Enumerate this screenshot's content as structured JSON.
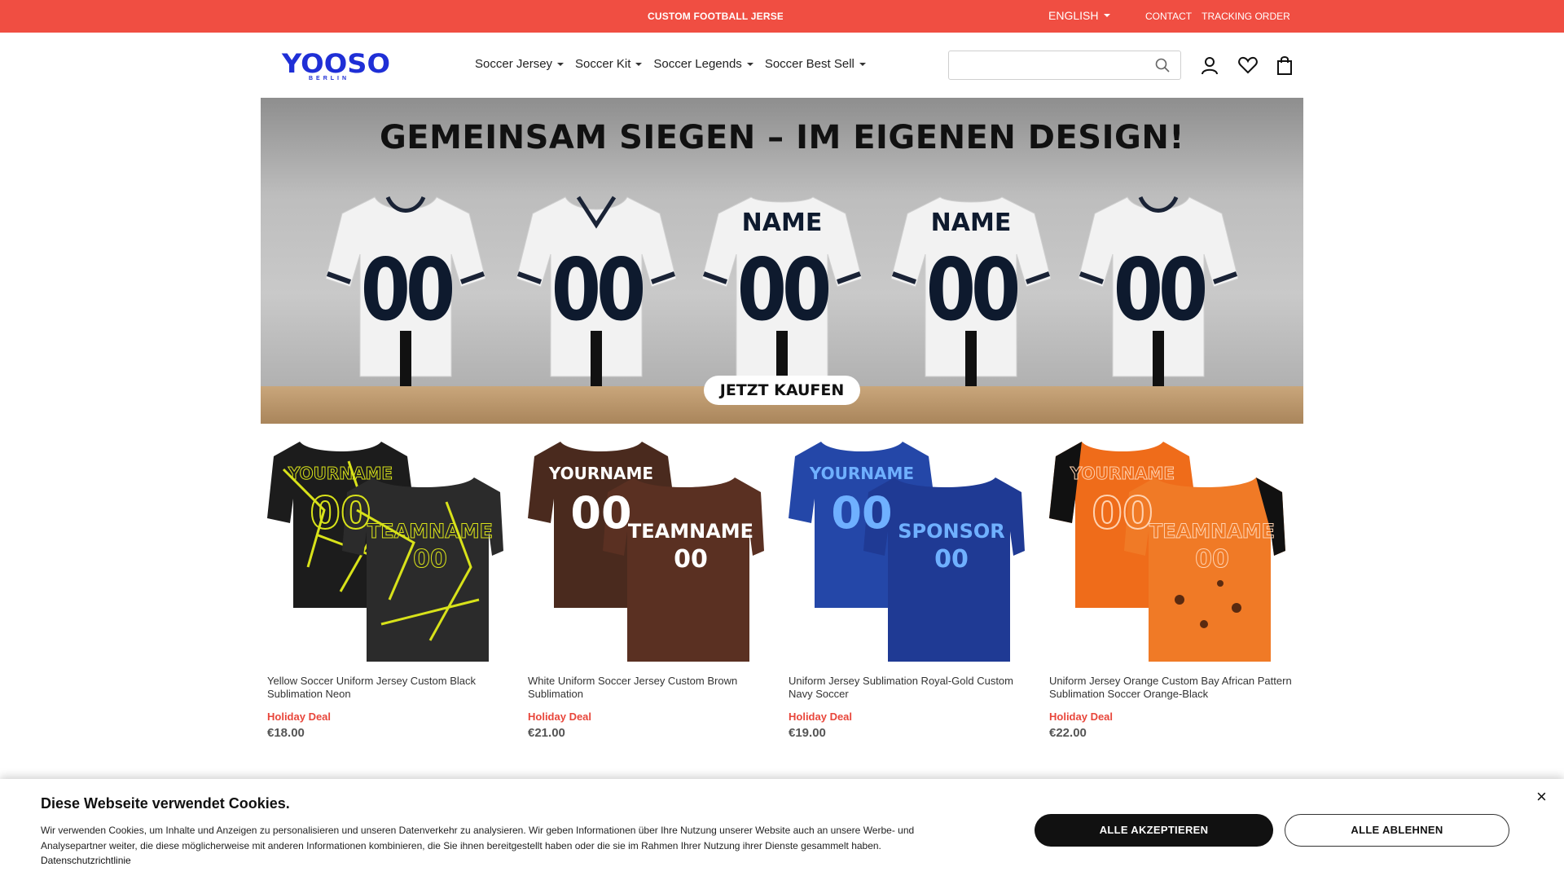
{
  "topbar": {
    "promo": "CUSTOM FOOTBALL JERSEY",
    "language": "ENGLISH",
    "links": [
      "CONTACT",
      "TRACKING ORDER"
    ]
  },
  "header": {
    "logo": {
      "brand": "YOOSO",
      "sub": "BERLIN"
    },
    "nav": [
      "Soccer Jersey",
      "Soccer Kit",
      "Soccer Legends",
      "Soccer Best Sell"
    ],
    "search": {
      "placeholder": "",
      "value": ""
    },
    "icons": [
      "search-icon",
      "account-icon",
      "wishlist-heart-icon",
      "cart-bag-icon"
    ]
  },
  "hero": {
    "headline": "GEMEINSAM SIEGEN – IM EIGENEN DESIGN!",
    "jerseys": [
      {
        "name": "",
        "number": "00"
      },
      {
        "name": "",
        "number": "00"
      },
      {
        "name": "NAME",
        "number": "00"
      },
      {
        "name": "NAME",
        "number": "00"
      },
      {
        "name": "",
        "number": "00"
      }
    ],
    "cta": "JETZT KAUFEN"
  },
  "products": [
    {
      "title": "Yellow Soccer Uniform Jersey Custom Black Sublimation Neon",
      "deal": "Holiday Deal",
      "price": "€18.00",
      "colors": {
        "base": "#1c1c1c",
        "accent": "#d8e21a"
      },
      "print": {
        "front_name": "YOURNAME",
        "front_number": "00",
        "back_name": "TEAMNAME",
        "back_number": "00"
      }
    },
    {
      "title": "White Uniform Soccer Jersey Custom Brown Sublimation",
      "deal": "Holiday Deal",
      "price": "€21.00",
      "colors": {
        "base": "#4a2a1e",
        "accent": "#ffffff"
      },
      "print": {
        "front_name": "YOURNAME",
        "front_number": "00",
        "back_name": "TEAMNAME",
        "back_number": "00"
      }
    },
    {
      "title": "Uniform Jersey Sublimation Royal-Gold Custom Navy Soccer",
      "deal": "Holiday Deal",
      "price": "€19.00",
      "colors": {
        "base": "#2447a8",
        "accent": "#6fb0ff"
      },
      "print": {
        "front_name": "YOURNAME",
        "front_number": "00",
        "back_name": "SPONSOR",
        "back_number": "00"
      }
    },
    {
      "title": "Uniform Jersey Orange Custom Bay African Pattern Sublimation Soccer Orange-Black",
      "deal": "Holiday Deal",
      "price": "€22.00",
      "colors": {
        "base": "#ef6c1a",
        "accent": "#ffb27a"
      },
      "print": {
        "front_name": "YOURNAME",
        "front_number": "00",
        "back_name": "TEAMNAME",
        "back_number": "00"
      }
    }
  ],
  "cookie": {
    "title": "Diese Webseite verwendet Cookies.",
    "text": "Wir verwenden Cookies, um Inhalte und Anzeigen zu personalisieren und unseren Datenverkehr zu analysieren. Wir geben Informationen über Ihre Nutzung unserer Website auch an unsere Werbe- und Analysepartner weiter, die diese möglicherweise mit anderen Informationen kombinieren, die Sie ihnen bereitgestellt haben oder die sie im Rahmen Ihrer Nutzung ihrer Dienste gesammelt haben.",
    "link": "Datenschutzrichtlinie",
    "accept": "ALLE AKZEPTIEREN",
    "reject": "ALLE ABLEHNEN",
    "close": "×"
  },
  "theme": {
    "topbar": "#f04e42",
    "logo": "#1f2fd6",
    "deal": "#e8463b"
  }
}
